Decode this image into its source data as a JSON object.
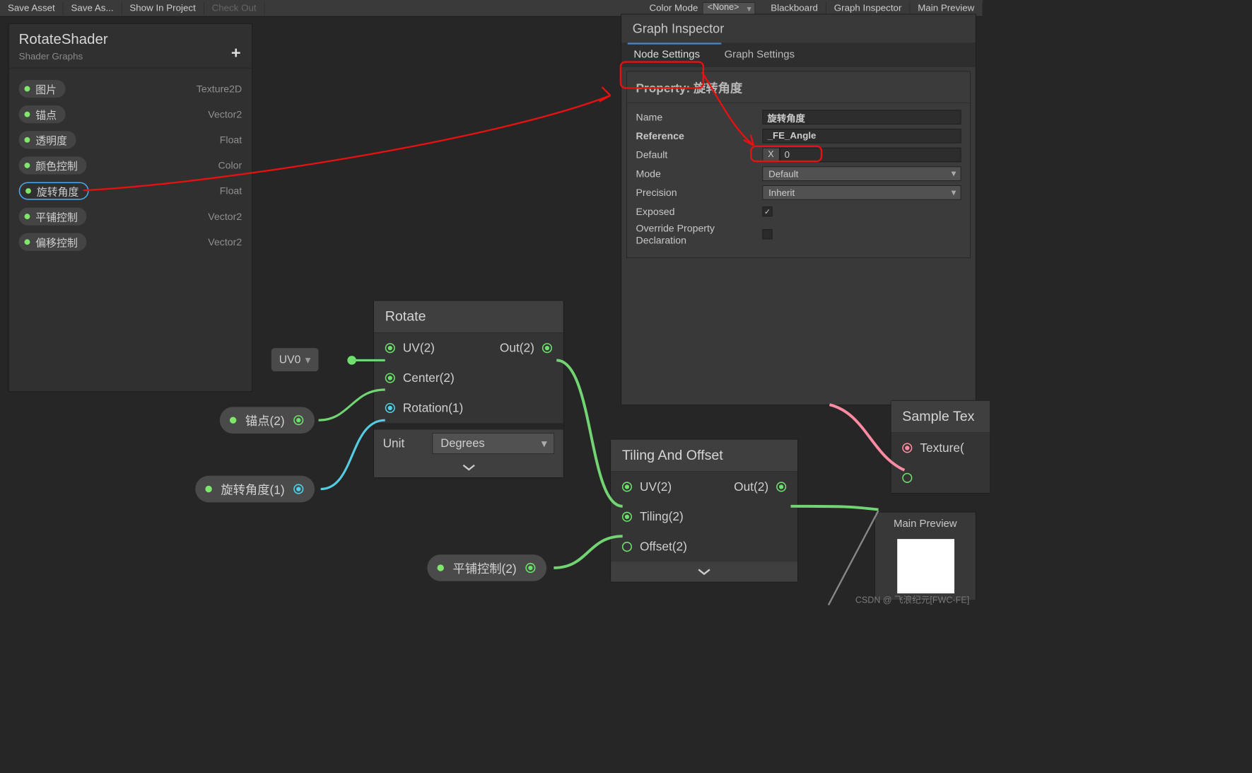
{
  "toolbar": {
    "buttons": [
      "Save Asset",
      "Save As...",
      "Show In Project",
      "Check Out"
    ],
    "colorModeLabel": "Color Mode",
    "colorModeValue": "<None>",
    "right": [
      "Blackboard",
      "Graph Inspector",
      "Main Preview"
    ]
  },
  "blackboard": {
    "title": "RotateShader",
    "subtitle": "Shader Graphs",
    "plus": "+",
    "props": [
      {
        "name": "图片",
        "type": "Texture2D",
        "sel": false
      },
      {
        "name": "锚点",
        "type": "Vector2",
        "sel": false
      },
      {
        "name": "透明度",
        "type": "Float",
        "sel": false
      },
      {
        "name": "颜色控制",
        "type": "Color",
        "sel": false
      },
      {
        "name": "旋转角度",
        "type": "Float",
        "sel": true
      },
      {
        "name": "平铺控制",
        "type": "Vector2",
        "sel": false
      },
      {
        "name": "偏移控制",
        "type": "Vector2",
        "sel": false
      }
    ]
  },
  "inspector": {
    "title": "Graph Inspector",
    "tabs": [
      "Node Settings",
      "Graph Settings"
    ],
    "propertyTitle": "Property: 旋转角度",
    "fields": {
      "nameLabel": "Name",
      "nameValue": "旋转角度",
      "refLabel": "Reference",
      "refValue": "_FE_Angle",
      "defLabel": "Default",
      "defX": "X",
      "defValue": "0",
      "modeLabel": "Mode",
      "modeValue": "Default",
      "precLabel": "Precision",
      "precValue": "Inherit",
      "expLabel": "Exposed",
      "expChecked": true,
      "ovrLabel": "Override Property Declaration",
      "ovrChecked": false
    }
  },
  "nodes": {
    "rotate": {
      "title": "Rotate",
      "uvLabel": "UV(2)",
      "centerLabel": "Center(2)",
      "rotLabel": "Rotation(1)",
      "outLabel": "Out(2)",
      "unitLabel": "Unit",
      "unitValue": "Degrees",
      "uvChip": "UV0"
    },
    "tiling": {
      "title": "Tiling And Offset",
      "uvLabel": "UV(2)",
      "tilingLabel": "Tiling(2)",
      "offsetLabel": "Offset(2)",
      "outLabel": "Out(2)"
    },
    "sample": {
      "title": "Sample Tex",
      "texLabel": "Texture("
    },
    "chips": {
      "anchor": "锚点(2)",
      "angle": "旋转角度(1)",
      "tile": "平铺控制(2)"
    }
  },
  "preview": {
    "title": "Main Preview"
  },
  "watermark": "CSDN @ 飞浪纪元[FWC-FE]"
}
